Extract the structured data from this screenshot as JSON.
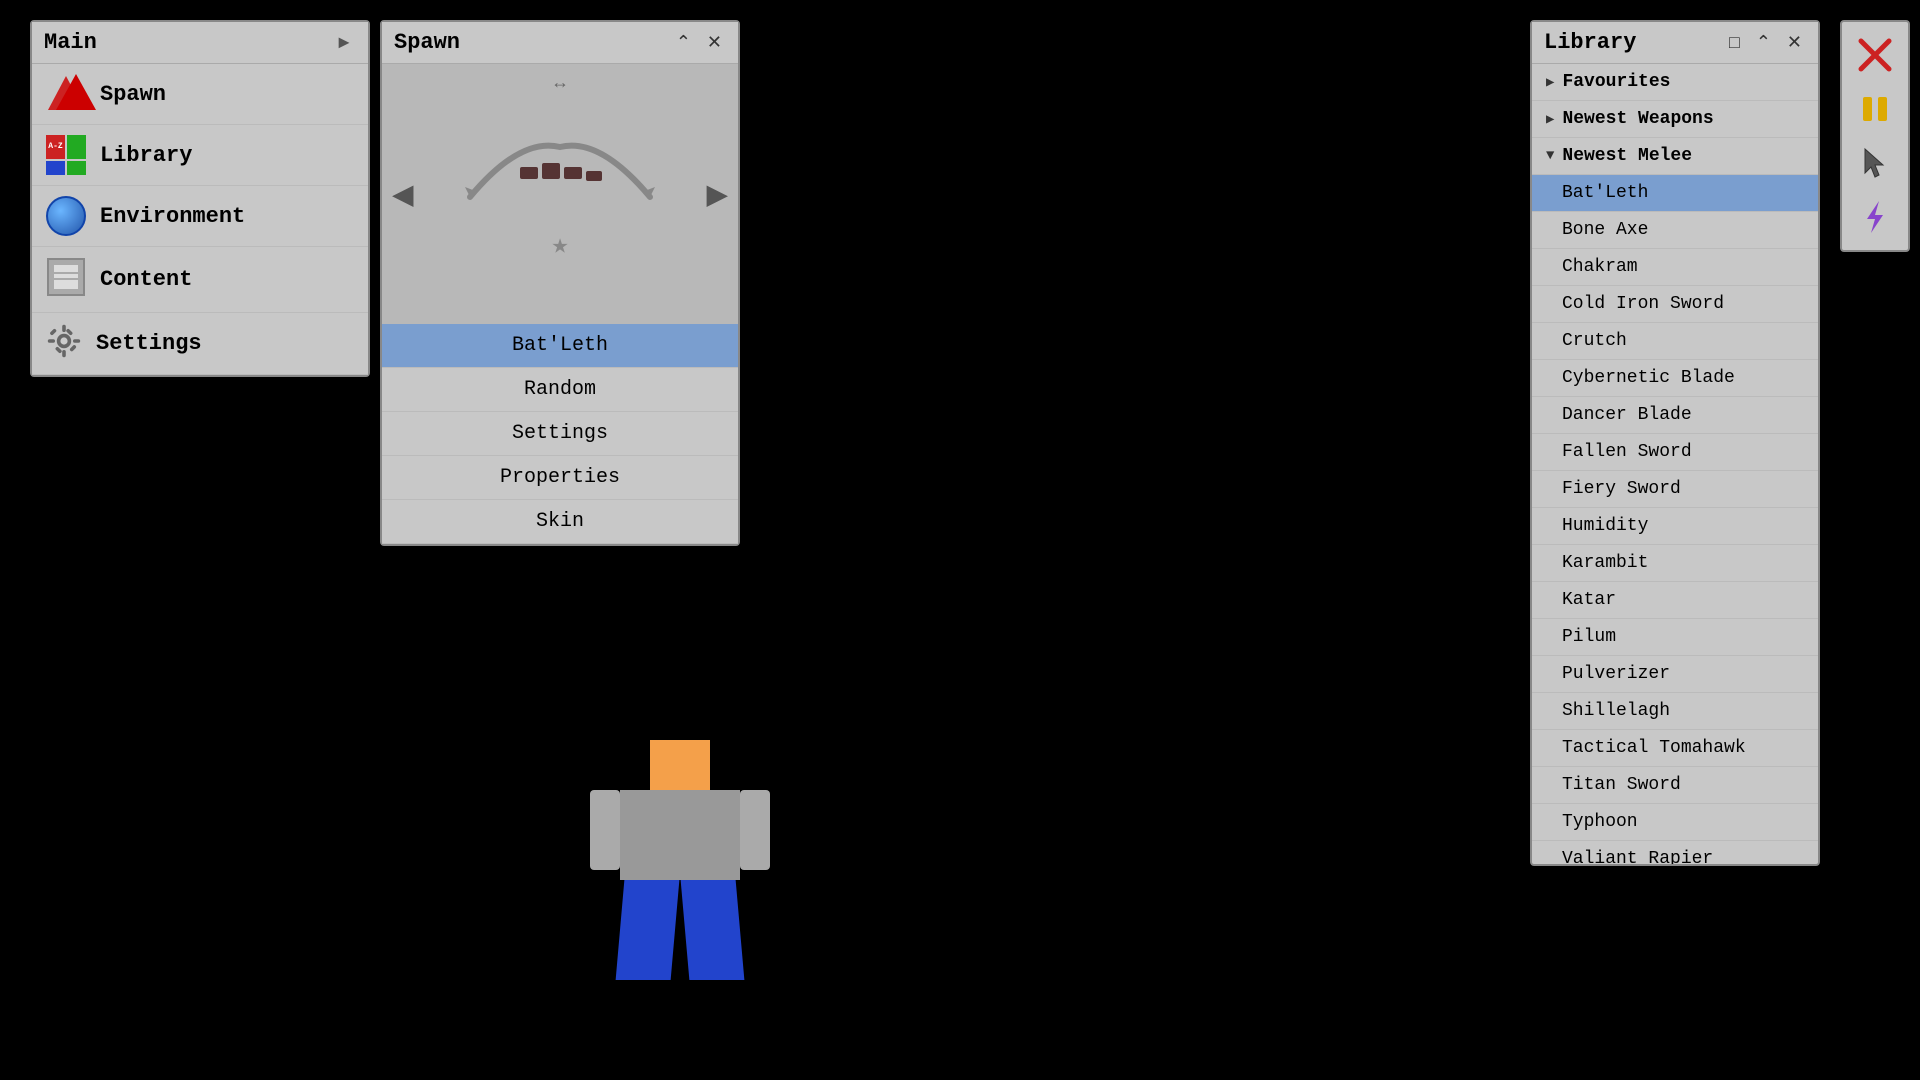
{
  "main_panel": {
    "title": "Main",
    "items": [
      {
        "id": "spawn",
        "label": "Spawn",
        "icon": "spawn-icon"
      },
      {
        "id": "library",
        "label": "Library",
        "icon": "library-icon"
      },
      {
        "id": "environment",
        "label": "Environment",
        "icon": "environment-icon"
      },
      {
        "id": "content",
        "label": "Content",
        "icon": "content-icon"
      },
      {
        "id": "settings",
        "label": "Settings",
        "icon": "settings-icon"
      }
    ]
  },
  "spawn_panel": {
    "title": "Spawn",
    "weapon_name": "Bat'Leth",
    "menu_items": [
      {
        "id": "bat-leth",
        "label": "Bat'Leth",
        "active": true
      },
      {
        "id": "random",
        "label": "Random",
        "active": false
      },
      {
        "id": "settings",
        "label": "Settings",
        "active": false
      },
      {
        "id": "properties",
        "label": "Properties",
        "active": false
      },
      {
        "id": "skin",
        "label": "Skin",
        "active": false
      }
    ]
  },
  "library_panel": {
    "title": "Library",
    "categories": [
      {
        "id": "favourites",
        "label": "Favourites",
        "expanded": false
      },
      {
        "id": "newest-weapons",
        "label": "Newest Weapons",
        "expanded": false
      },
      {
        "id": "newest-melee",
        "label": "Newest Melee",
        "expanded": true
      }
    ],
    "items": [
      {
        "id": "batleth",
        "label": "Bat'Leth",
        "selected": true
      },
      {
        "id": "bone-axe",
        "label": "Bone Axe"
      },
      {
        "id": "chakram",
        "label": "Chakram"
      },
      {
        "id": "cold-iron-sword",
        "label": "Cold Iron Sword"
      },
      {
        "id": "crutch",
        "label": "Crutch"
      },
      {
        "id": "cybernetic-blade",
        "label": "Cybernetic Blade"
      },
      {
        "id": "dancer-blade",
        "label": "Dancer Blade"
      },
      {
        "id": "fallen-sword",
        "label": "Fallen Sword"
      },
      {
        "id": "fiery-sword",
        "label": "Fiery Sword"
      },
      {
        "id": "humidity",
        "label": "Humidity"
      },
      {
        "id": "karambit",
        "label": "Karambit"
      },
      {
        "id": "katar",
        "label": "Katar"
      },
      {
        "id": "pilum",
        "label": "Pilum"
      },
      {
        "id": "pulverizer",
        "label": "Pulverizer"
      },
      {
        "id": "shillelagh",
        "label": "Shillelagh"
      },
      {
        "id": "tactical-tomahawk",
        "label": "Tactical Tomahawk"
      },
      {
        "id": "titan-sword",
        "label": "Titan Sword"
      },
      {
        "id": "typhoon",
        "label": "Typhoon"
      },
      {
        "id": "valiant-rapier",
        "label": "Valiant Rapier"
      }
    ]
  },
  "toolbar": {
    "buttons": [
      {
        "id": "close",
        "label": "✕",
        "color": "#cc2222"
      },
      {
        "id": "pause",
        "label": "⏸",
        "color": "#ddaa00"
      },
      {
        "id": "cursor",
        "label": "↖",
        "color": "#555"
      },
      {
        "id": "lightning",
        "label": "⚡",
        "color": "#8844cc"
      }
    ]
  }
}
